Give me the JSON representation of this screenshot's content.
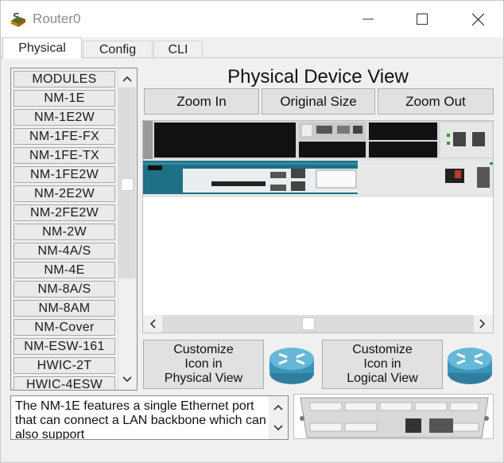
{
  "window": {
    "title": "Router0",
    "icon": "router-app-icon"
  },
  "tabs": [
    {
      "label": "Physical",
      "active": true
    },
    {
      "label": "Config",
      "active": false
    },
    {
      "label": "CLI",
      "active": false
    }
  ],
  "modules": {
    "header": "MODULES",
    "items": [
      "NM-1E",
      "NM-1E2W",
      "NM-1FE-FX",
      "NM-1FE-TX",
      "NM-1FE2W",
      "NM-2E2W",
      "NM-2FE2W",
      "NM-2W",
      "NM-4A/S",
      "NM-4E",
      "NM-8A/S",
      "NM-8AM",
      "NM-Cover",
      "NM-ESW-161",
      "HWIC-2T",
      "HWIC-4ESW"
    ]
  },
  "device_view": {
    "title": "Physical Device View",
    "zoom_in": "Zoom In",
    "original_size": "Original Size",
    "zoom_out": "Zoom Out"
  },
  "customize": {
    "physical_label": "Customize\nIcon in\nPhysical View",
    "logical_label": "Customize\nIcon in\nLogical View"
  },
  "description": {
    "text": "The NM-1E features a single Ethernet port that can connect a LAN backbone which can also support"
  },
  "colors": {
    "router_teal": "#1f6f86",
    "router_icon_blue": "#3b95b8",
    "chassis_black": "#1a1a1a"
  }
}
